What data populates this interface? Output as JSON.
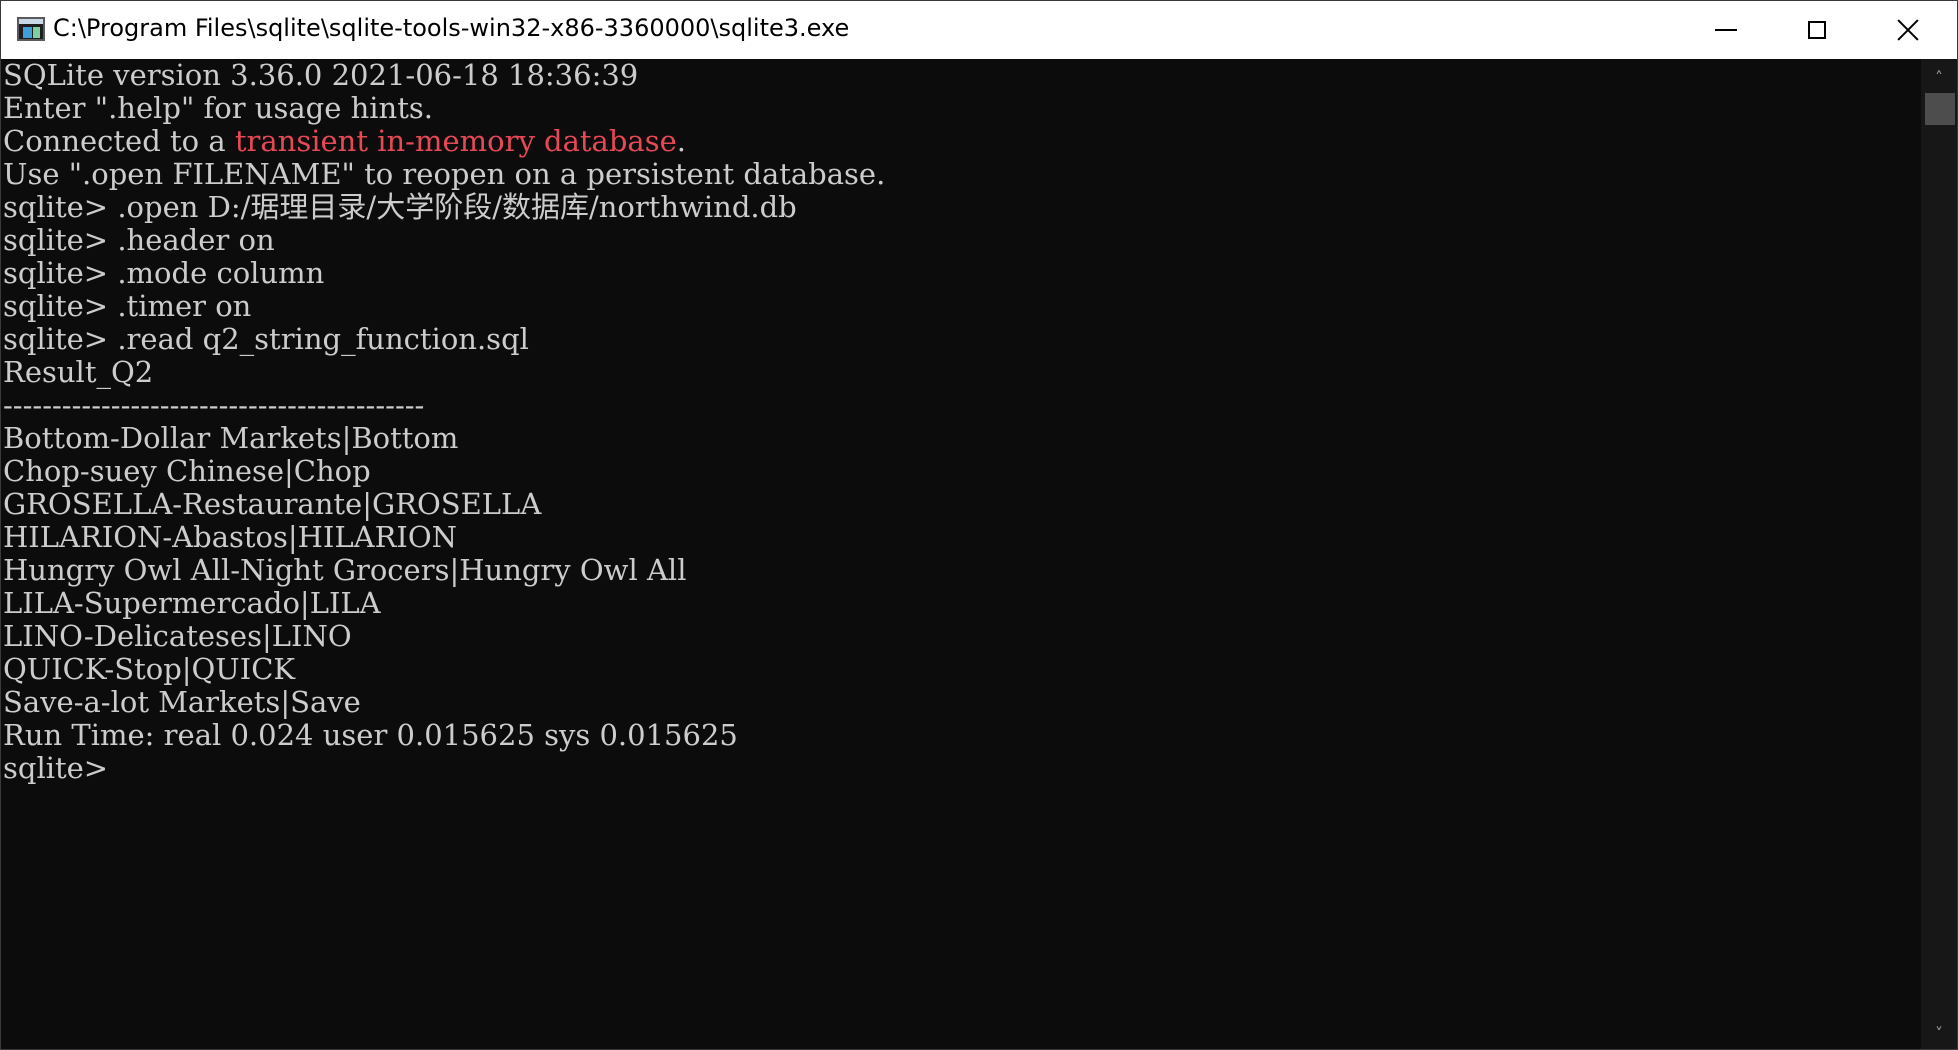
{
  "window": {
    "title": "C:\\Program Files\\sqlite\\sqlite-tools-win32-x86-3360000\\sqlite3.exe",
    "icon": "console-app-icon"
  },
  "controls": {
    "minimize_icon": "minimize-icon",
    "maximize_icon": "maximize-icon",
    "close_icon": "close-icon"
  },
  "colors": {
    "background": "#0c0c0c",
    "text": "#cccccc",
    "highlight": "#e74856"
  },
  "console": {
    "version_line": "SQLite version 3.36.0 2021-06-18 18:36:39",
    "help_line": "Enter \".help\" for usage hints.",
    "connected_prefix": "Connected to a ",
    "connected_highlight": "transient in-memory database",
    "connected_suffix": ".",
    "open_hint": "Use \".open FILENAME\" to reopen on a persistent database.",
    "commands": [
      "sqlite> .open D:/琚理目录/大学阶段/数据库/northwind.db",
      "sqlite> .header on",
      "sqlite> .mode column",
      "sqlite> .timer on",
      "sqlite> .read q2_string_function.sql"
    ],
    "result_header": "Result_Q2",
    "separator": "-------------------------------------------",
    "results": [
      "Bottom-Dollar Markets|Bottom",
      "Chop-suey Chinese|Chop",
      "GROSELLA-Restaurante|GROSELLA",
      "HILARION-Abastos|HILARION",
      "Hungry Owl All-Night Grocers|Hungry Owl All",
      "LILA-Supermercado|LILA",
      "LINO-Delicateses|LINO",
      "QUICK-Stop|QUICK",
      "Save-a-lot Markets|Save"
    ],
    "run_time": "Run Time: real 0.024 user 0.015625 sys 0.015625",
    "prompt": "sqlite> "
  },
  "scrollbar": {
    "up_arrow": "˄",
    "down_arrow": "˅"
  }
}
